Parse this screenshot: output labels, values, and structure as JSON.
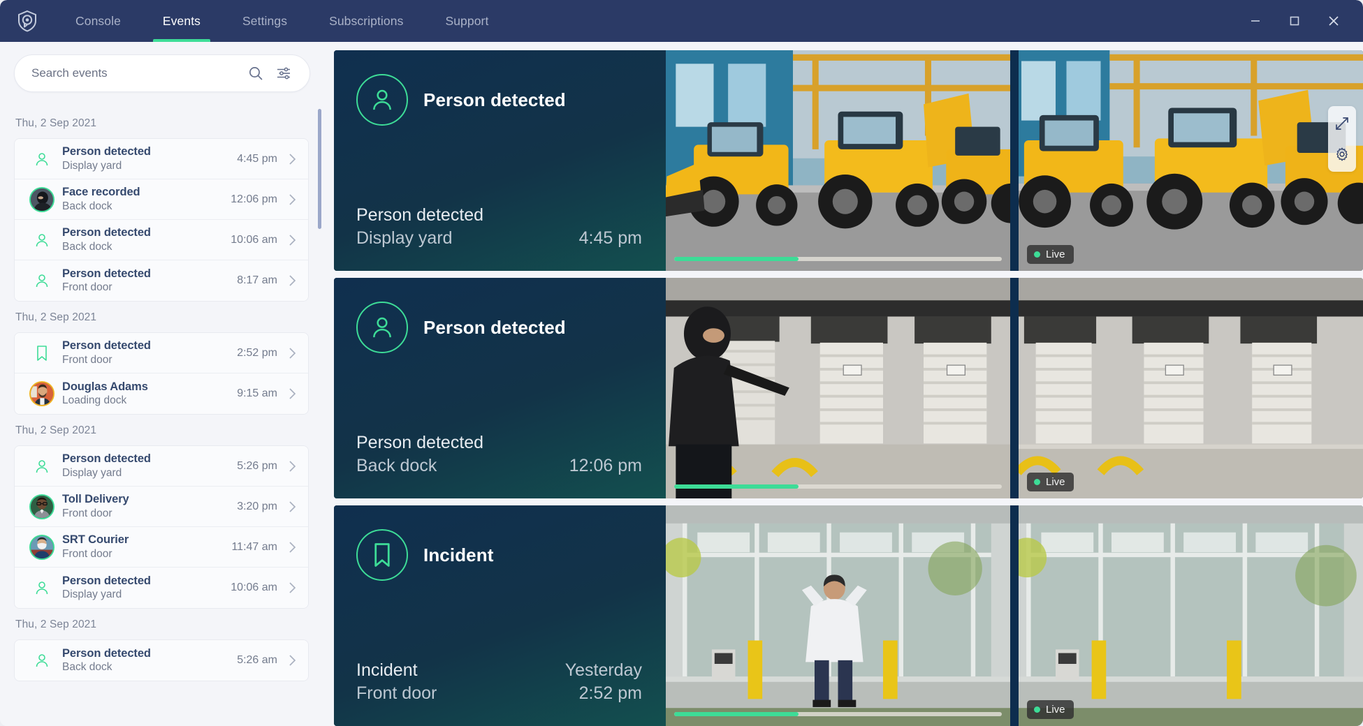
{
  "app": {
    "logo_icon": "shield-camera-logo",
    "nav": [
      {
        "label": "Console",
        "active": false
      },
      {
        "label": "Events",
        "active": true
      },
      {
        "label": "Settings",
        "active": false
      },
      {
        "label": "Subscriptions",
        "active": false
      },
      {
        "label": "Support",
        "active": false
      }
    ],
    "window_controls": [
      {
        "name": "minimize",
        "icon": "minimize-icon"
      },
      {
        "name": "maximize",
        "icon": "maximize-icon"
      },
      {
        "name": "close",
        "icon": "close-icon"
      }
    ],
    "colors": {
      "navbar": "#2b3a66",
      "accent_green": "#3ddc97",
      "title_blue": "#35496e",
      "card_gradient_start": "#102f4f",
      "card_gradient_end": "#13504f"
    }
  },
  "search": {
    "placeholder": "Search events",
    "value": "",
    "search_icon": "search-icon",
    "filter_icon": "filter-sliders-icon"
  },
  "event_groups": [
    {
      "date": "Thu, 2 Sep 2021",
      "events": [
        {
          "icon": "person-outline-icon",
          "title": "Person detected",
          "location": "Display yard",
          "time": "4:45 pm"
        },
        {
          "icon": "avatar-photo",
          "avatar": "masked-person",
          "avatar_ring": "green",
          "title": "Face recorded",
          "location": "Back dock",
          "time": "12:06 pm"
        },
        {
          "icon": "person-outline-icon",
          "title": "Person detected",
          "location": "Back dock",
          "time": "10:06 am"
        },
        {
          "icon": "person-outline-icon",
          "title": "Person detected",
          "location": "Front door",
          "time": "8:17 am"
        }
      ]
    },
    {
      "date": "Thu, 2 Sep 2021",
      "events": [
        {
          "icon": "bookmark-outline-icon",
          "title": "Person detected",
          "location": "Front door",
          "time": "2:52 pm"
        },
        {
          "icon": "avatar-photo",
          "avatar": "bearded-man",
          "avatar_ring": "gold",
          "title": "Douglas Adams",
          "location": "Loading dock",
          "time": "9:15 am"
        }
      ]
    },
    {
      "date": "Thu, 2 Sep 2021",
      "events": [
        {
          "icon": "person-outline-icon",
          "title": "Person detected",
          "location": "Display yard",
          "time": "5:26 pm"
        },
        {
          "icon": "avatar-photo",
          "avatar": "glasses-man",
          "avatar_ring": "green",
          "title": "Toll Delivery",
          "location": "Front door",
          "time": "3:20 pm"
        },
        {
          "icon": "avatar-photo",
          "avatar": "masked-courier",
          "avatar_ring": "green",
          "title": "SRT Courier",
          "location": "Front door",
          "time": "11:47 am"
        },
        {
          "icon": "person-outline-icon",
          "title": "Person detected",
          "location": "Display yard",
          "time": "10:06 am"
        }
      ]
    },
    {
      "date": "Thu, 2 Sep 2021",
      "events": [
        {
          "icon": "person-outline-icon",
          "title": "Person detected",
          "location": "Back dock",
          "time": "5:26 am"
        }
      ]
    }
  ],
  "cards": [
    {
      "badge_icon": "person-outline-icon",
      "heading": "Person detected",
      "foot_title": "Person detected",
      "foot_location": "Display yard",
      "foot_time": "4:45 pm",
      "foot_day": "",
      "scene": "construction-yard",
      "progress_percent": 38,
      "live_label": "Live"
    },
    {
      "badge_icon": "person-outline-icon",
      "heading": "Person detected",
      "foot_title": "Person detected",
      "foot_location": "Back dock",
      "foot_time": "12:06 pm",
      "foot_day": "",
      "scene": "loading-dock",
      "progress_percent": 38,
      "live_label": "Live"
    },
    {
      "badge_icon": "bookmark-outline-icon",
      "heading": "Incident",
      "foot_title": "Incident",
      "foot_location": "Front door",
      "foot_time": "2:52 pm",
      "foot_day": "Yesterday",
      "scene": "front-door",
      "progress_percent": 38,
      "live_label": "Live"
    }
  ],
  "tools": [
    {
      "name": "expand-icon"
    },
    {
      "name": "settings-gear-icon"
    }
  ]
}
